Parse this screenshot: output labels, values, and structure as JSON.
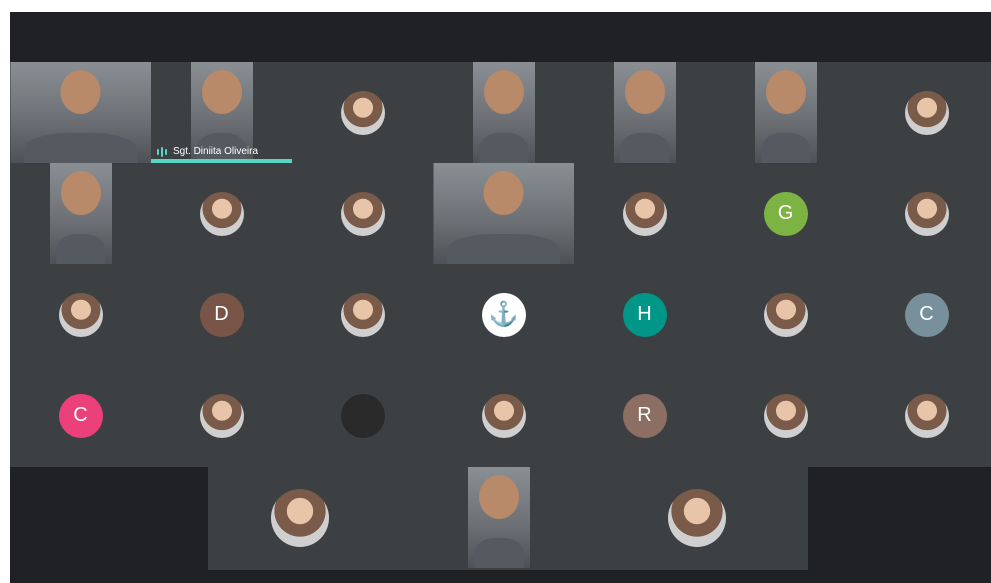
{
  "meeting": {
    "speaker": {
      "name": "Sgt. Diniita Oliveira",
      "icon": "audio-activity-icon",
      "accent_color": "#58d6c4"
    },
    "rows": [
      {
        "tiles": [
          {
            "kind": "video",
            "name": "participant-video-1",
            "aspect": "full"
          },
          {
            "kind": "video",
            "name": "participant-video-2",
            "aspect": "portrait",
            "speaker": true
          },
          {
            "kind": "photo",
            "name": "participant-avatar-3"
          },
          {
            "kind": "video",
            "name": "participant-video-4",
            "aspect": "portrait"
          },
          {
            "kind": "video",
            "name": "participant-video-5",
            "aspect": "portrait"
          },
          {
            "kind": "video",
            "name": "participant-video-6",
            "aspect": "portrait"
          },
          {
            "kind": "photo",
            "name": "participant-avatar-7"
          }
        ]
      },
      {
        "tiles": [
          {
            "kind": "video",
            "name": "participant-video-8",
            "aspect": "portrait"
          },
          {
            "kind": "photo",
            "name": "participant-avatar-9"
          },
          {
            "kind": "photo",
            "name": "participant-avatar-10"
          },
          {
            "kind": "video",
            "name": "participant-video-11",
            "aspect": "full"
          },
          {
            "kind": "photo",
            "name": "participant-avatar-12"
          },
          {
            "kind": "initial",
            "name": "participant-avatar-13",
            "letter": "G",
            "color": "#7cb342"
          },
          {
            "kind": "photo",
            "name": "participant-avatar-14"
          }
        ]
      },
      {
        "tiles": [
          {
            "kind": "photo",
            "name": "participant-avatar-15"
          },
          {
            "kind": "initial",
            "name": "participant-avatar-16",
            "letter": "D",
            "color": "#795548"
          },
          {
            "kind": "photo",
            "name": "participant-avatar-17"
          },
          {
            "kind": "anchor",
            "name": "participant-avatar-18",
            "letter": "⚓"
          },
          {
            "kind": "initial",
            "name": "participant-avatar-19",
            "letter": "H",
            "color": "#009688"
          },
          {
            "kind": "photo",
            "name": "participant-avatar-20"
          },
          {
            "kind": "initial",
            "name": "participant-avatar-21",
            "letter": "C",
            "color": "#78909c"
          }
        ]
      },
      {
        "tiles": [
          {
            "kind": "initial",
            "name": "participant-avatar-22",
            "letter": "C",
            "color": "#ec407a"
          },
          {
            "kind": "photo",
            "name": "participant-avatar-23"
          },
          {
            "kind": "dark",
            "name": "participant-avatar-24"
          },
          {
            "kind": "photo",
            "name": "participant-avatar-25"
          },
          {
            "kind": "initial",
            "name": "participant-avatar-26",
            "letter": "R",
            "color": "#8d6e63"
          },
          {
            "kind": "photo",
            "name": "participant-avatar-27"
          },
          {
            "kind": "photo",
            "name": "participant-avatar-28"
          }
        ]
      },
      {
        "tiles": [
          {
            "kind": "photo",
            "name": "participant-avatar-29"
          },
          {
            "kind": "video",
            "name": "participant-video-30",
            "aspect": "portrait"
          },
          {
            "kind": "photo",
            "name": "participant-avatar-31"
          }
        ]
      }
    ]
  }
}
